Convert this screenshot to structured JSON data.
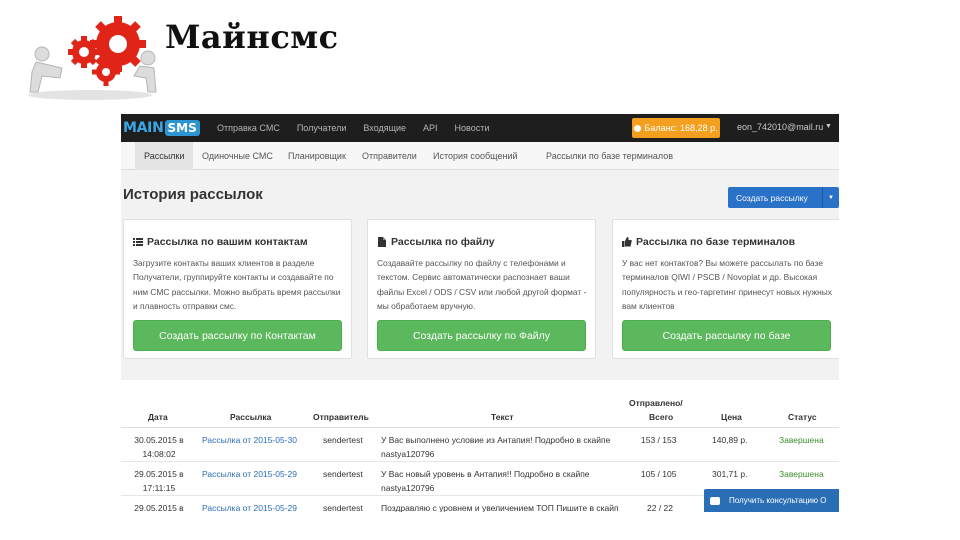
{
  "slide": {
    "title": "Майнсмс"
  },
  "topnav": {
    "brand_main": "MAIN",
    "brand_sms": "SMS",
    "items": [
      "Отправка СМС",
      "Получатели",
      "Входящие",
      "API",
      "Новости"
    ],
    "balance": "Баланс: 168,28 р.",
    "user_email": "eon_742010@mail.ru"
  },
  "subnav": {
    "items": [
      "Рассылки",
      "Одиночные СМС",
      "Планировщик",
      "Отправители",
      "История сообщений",
      "Рассылки по базе терминалов"
    ],
    "active_index": 0
  },
  "page": {
    "title": "История рассылок",
    "create_button": "Создать рассылку"
  },
  "cards": [
    {
      "title": "Рассылка по вашим контактам",
      "icon": "list-icon",
      "text": "Загрузите контакты ваших клиентов в разделе Получатели, группируйте контакты и создавайте по ним СМС рассылки. Можно выбрать время рассылки и плавность отправки смс.",
      "button": "Создать рассылку по Контактам"
    },
    {
      "title": "Рассылка по файлу",
      "icon": "file-icon",
      "text": "Создавайте рассылку по файлу с телефонами и текстом. Сервис автоматически распознает ваши файлы Excel / ODS / CSV или любой другой формат - мы обработаем вручную.",
      "button": "Создать рассылку по Файлу"
    },
    {
      "title": "Рассылка по базе терминалов",
      "icon": "thumbs-up-icon",
      "text": "У вас нет контактов? Вы можете рассылать по базе терминалов QIWI / PSCB / Novoplat и др. Высокая популярность и гео-таргетинг принесут новых нужных вам клиентов",
      "button": "Создать рассылку по базе"
    }
  ],
  "table": {
    "headers": {
      "date": "Дата",
      "mailing": "Рассылка",
      "sender": "Отправитель",
      "text": "Текст",
      "sent_top": "Отправлено/",
      "sent_bottom": "Всего",
      "price": "Цена",
      "status": "Статус"
    },
    "rows": [
      {
        "date": "30.05.2015 в 14:08:02",
        "mailing": "Рассылка от 2015-05-30",
        "sender": "sendertest",
        "text": "У Вас выполнено условие из Антапия! Подробно в скайпе nastya120796",
        "sent": "153 / 153",
        "price": "140,89 р.",
        "status": "Завершена"
      },
      {
        "date": "29.05.2015 в 17:11:15",
        "mailing": "Рассылка от 2015-05-29",
        "sender": "sendertest",
        "text": "У Вас новый уровень в Антапия!! Подробно в скайпе nastya120796",
        "sent": "105 / 105",
        "price": "301,71 р.",
        "status": "Завершена"
      },
      {
        "date": "29.05.2015 в",
        "mailing": "Рассылка от 2015-05-29",
        "sender": "sendertest",
        "text": "Поздравляю с уровнем и увеличением ТОП Пишите в скайп",
        "sent": "22 / 22",
        "price": "",
        "status": ""
      }
    ]
  },
  "consult_button": "Получить консультацию О"
}
